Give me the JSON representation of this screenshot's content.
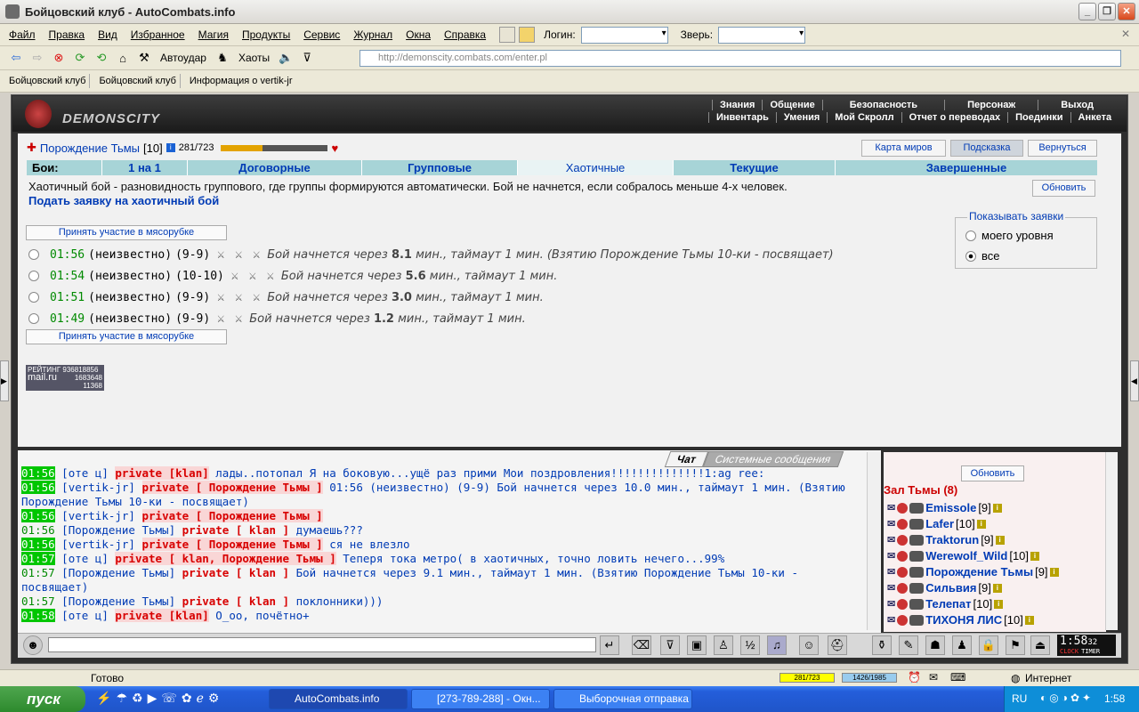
{
  "window": {
    "title": "Бойцовский клуб - AutoCombats.info"
  },
  "menu": {
    "items": [
      "Файл",
      "Правка",
      "Вид",
      "Избранное",
      "Магия",
      "Продукты",
      "Сервис",
      "Журнал",
      "Окна",
      "Справка"
    ],
    "login_label": "Логин:",
    "beast_label": "Зверь:"
  },
  "nav": {
    "autoudar_label": "Автоудар",
    "haoty_label": "Хаоты",
    "address": "http://demonscity.combats.com/enter.pl"
  },
  "tabs": [
    "Бойцовский клуб",
    "Бойцовский клуб",
    "Информация о vertik-jr"
  ],
  "game": {
    "logo_text": "DEMONSCITY",
    "topnav_row1": [
      "Знания",
      "Общение",
      "Безопасность",
      "Персонаж",
      "Выход"
    ],
    "topnav_row2": [
      "Инвентарь",
      "Умения",
      "Мой Скролл",
      "Отчет о переводах",
      "Поединки",
      "Анкета"
    ],
    "character": {
      "name": "Порождение Тьмы",
      "level": "[10]",
      "hp": "281/723",
      "hp_fraction": 0.389
    },
    "right_buttons": [
      "Карта миров",
      "Подсказка",
      "Вернуться"
    ],
    "battle_tabs": [
      "Бои:",
      "1 на 1",
      "Договорные",
      "Групповые",
      "Хаотичные",
      "Текущие",
      "Завершенные"
    ],
    "description": "Хаотичный бой - разновидность группового, где группы формируются автоматически. Бой не начнется, если собралось меньше 4-х человек.",
    "submit_link": "Подать заявку на хаотичный бой",
    "refresh_label": "Обновить",
    "join_label": "Принять участие в мясорубке",
    "battles": [
      {
        "time": "01:56",
        "who": "(неизвестно)",
        "lvl": "(9-9)",
        "pre": "Бой начнется через ",
        "mins": "8.1",
        "post": " мин., таймаут 1 мин. (Взятию Порождение Тьмы 10-ки - посвящает)"
      },
      {
        "time": "01:54",
        "who": "(неизвестно)",
        "lvl": "(10-10)",
        "pre": "Бой начнется через ",
        "mins": "5.6",
        "post": " мин., таймаут 1 мин."
      },
      {
        "time": "01:51",
        "who": "(неизвестно)",
        "lvl": "(9-9)",
        "pre": "Бой начнется через ",
        "mins": "3.0",
        "post": " мин., таймаут 1 мин."
      },
      {
        "time": "01:49",
        "who": "(неизвестно)",
        "lvl": "(9-9)",
        "pre": "Бой начнется через ",
        "mins": "1.2",
        "post": " мин., таймаут 1 мин."
      }
    ],
    "filter": {
      "title": "Показывать заявки",
      "opt1": "моего уровня",
      "opt2": "все"
    },
    "rating": {
      "line1": "РЕЙТИНГ 936818856",
      "line2": "mail.ru",
      "n1": "1683648",
      "n2": "11368"
    }
  },
  "chat": {
    "tabs": [
      "Чат",
      "Системные сообщения"
    ],
    "lines": [
      {
        "t": "01:56",
        "n": "[оте ц]",
        "p": "private [klan]",
        "m": " лады..потопал Я на боковую...ущё раз прими Мои поздровления!!!!!!!!!!!!!!1:ag ree:"
      },
      {
        "t": "01:56",
        "n": "[vertik-jr]",
        "p": "private [ Порождение Тьмы ]",
        "m": " 01:56 (неизвестно) (9-9) Бой начнется через 10.0 мин., таймаут 1 мин. (Взятию"
      },
      {
        "cont": "Порождение Тьмы 10-ки - посвящает)"
      },
      {
        "t": "01:56",
        "n": "[vertik-jr]",
        "p": "private [ Порождение Тьмы ]",
        "m": ""
      },
      {
        "t": "01:56",
        "n": "[Порождение Тьмы]",
        "p": "private [ klan ]",
        "m": " думаешь???",
        "plain": true
      },
      {
        "t": "01:56",
        "n": "[vertik-jr]",
        "p": "private [ Порождение Тьмы ]",
        "m": " ся не влезло"
      },
      {
        "t": "01:57",
        "n": "[оте ц]",
        "p": "private [ klan, Порождение Тьмы ]",
        "m": " Теперя тока метро( в хаотичных, точно ловить нечего...99%"
      },
      {
        "t": "01:57",
        "n": "[Порождение Тьмы]",
        "p": "private [ klan ]",
        "m": " Бой начнется через 9.1 мин., таймаут 1 мин. (Взятию Порождение Тьмы 10-ки -",
        "plain": true
      },
      {
        "cont": "посвящает)"
      },
      {
        "t": "01:57",
        "n": "[Порождение Тьмы]",
        "p": "private [ klan ]",
        "m": " поклонники)))",
        "plain": true
      },
      {
        "t": "01:58",
        "n": "[оте ц]",
        "p": "private [klan]",
        "m": " О_оо, почётно+"
      }
    ]
  },
  "users": {
    "refresh": "Обновить",
    "hall": "Зал Тьмы (8)",
    "list": [
      {
        "name": "Emissole",
        "lvl": "[9]"
      },
      {
        "name": "Lafer",
        "lvl": "[10]"
      },
      {
        "name": "Traktorun",
        "lvl": "[9]"
      },
      {
        "name": "Werewolf_Wild",
        "lvl": "[10]"
      },
      {
        "name": "Порождение Тьмы",
        "lvl": "[9]"
      },
      {
        "name": "Сильвия",
        "lvl": "[9]"
      },
      {
        "name": "Телепат",
        "lvl": "[10]"
      },
      {
        "name": "ТИХОНЯ ЛИС",
        "lvl": "[10]"
      }
    ]
  },
  "clock": {
    "time": "1:58",
    "sec": "32",
    "l1": "CLOCK",
    "l2": "TIMER"
  },
  "status": {
    "text": "Готово",
    "hp": "281/723",
    "mana": "1426/1985",
    "zone": "Интернет"
  },
  "taskbar": {
    "start": "пуск",
    "tasks": [
      "AutoCombats.info",
      "[273-789-288] - Окн...",
      "Выборочная отправка"
    ],
    "lang": "RU",
    "time": "1:58"
  }
}
